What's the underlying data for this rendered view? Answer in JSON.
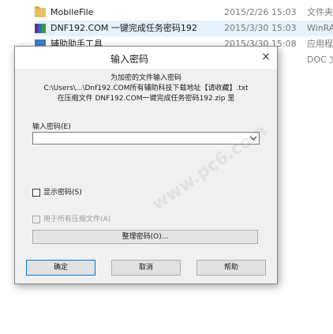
{
  "explorer": {
    "files": [
      {
        "icon": "folder-icon",
        "name": "MobileFile",
        "date": "2015/2/26 15:03",
        "type": "文件夹"
      },
      {
        "icon": "rar-archive-icon",
        "name": "DNF192.COM 一键完成任务密码192",
        "date": "2015/3/30 15:03",
        "type": "WinRAR"
      },
      {
        "icon": "executable-icon",
        "name": "辅助助手工具",
        "date": "2015/3/30 15:08",
        "type": "应用程序"
      },
      {
        "icon": "document-icon",
        "name": "",
        "date": "",
        "type": "DOC 文"
      }
    ]
  },
  "dialog": {
    "title": "输入密码",
    "close_glyph": "×",
    "info_line1": "为加密的文件输入密码",
    "info_line2": "C:\\Users\\...\\Dnf192.COM所有辅助科技下载地址【请收藏】.txt",
    "info_line3": "在压缩文件 DNF192.COM一键完成任务密码192.zip 里",
    "password_label": "输入密码(E)",
    "password_value": "",
    "show_password_label": "显示密码(S)",
    "use_for_all_label": "用于所有压缩文件(A)",
    "manage_button": "整理密码(O)...",
    "ok_button": "确定",
    "cancel_button": "取消",
    "help_button": "帮助"
  },
  "watermark": {
    "text": "www.pc6.com"
  },
  "colors": {
    "dialog_bg": "#f0f0f0",
    "selected_row": "#e5f1fb",
    "default_button_border": "#0078d7"
  }
}
